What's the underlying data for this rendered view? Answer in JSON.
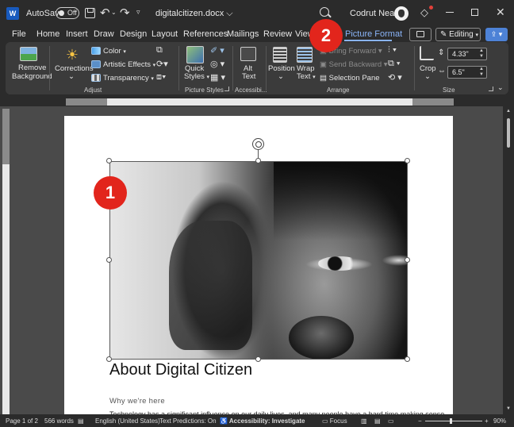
{
  "titlebar": {
    "autosave_label": "AutoSave",
    "autosave_state": "Off",
    "doc_title": "digitalcitizen.docx",
    "doc_title_caret": "⌵",
    "user_name": "Codrut Neagu",
    "app_logo": "W"
  },
  "tabs": [
    "File",
    "Home",
    "Insert",
    "Draw",
    "Design",
    "Layout",
    "References",
    "Mailings",
    "Review",
    "View",
    "Picture Format"
  ],
  "active_tab": "Picture Format",
  "editing_label": "Editing",
  "ribbon": {
    "remove_background": [
      "Remove",
      "Background"
    ],
    "corrections": "Corrections",
    "color": "Color",
    "artistic_effects": "Artistic Effects",
    "transparency": "Transparency",
    "adjust_label": "Adjust",
    "quick_styles": [
      "Quick",
      "Styles"
    ],
    "picture_styles_label": "Picture Styles",
    "alt_text": [
      "Alt",
      "Text"
    ],
    "accessibility_label": "Accessibi...",
    "position": "Position",
    "wrap_text": [
      "Wrap",
      "Text"
    ],
    "bring_forward": "Bring Forward",
    "send_backward": "Send Backward",
    "selection_pane": "Selection Pane",
    "arrange_label": "Arrange",
    "crop": "Crop",
    "height_value": "4.33\"",
    "width_value": "6.5\"",
    "size_label": "Size"
  },
  "document": {
    "heading": "About Digital Citizen",
    "subheading": "Why we're here",
    "body_preview": "Technology has a significant influence on our daily lives, and many people have a hard time making sense"
  },
  "callouts": [
    "1",
    "2"
  ],
  "statusbar": {
    "page": "Page 1 of 2",
    "words": "566 words",
    "language": "English (United States)",
    "predictions": "Text Predictions: On",
    "accessibility": "Accessibility: Investigate",
    "focus": "Focus",
    "zoom_minus": "−",
    "zoom_plus": "+",
    "zoom": "90%"
  },
  "zoom_level": 0.9,
  "colors": {
    "accent": "#8ab4f8",
    "callout": "#e2251c",
    "share": "#4d82d6",
    "word_blue": "#185abd"
  },
  "icons": [
    "word-logo-icon",
    "save-icon",
    "undo-icon",
    "redo-icon",
    "search-icon",
    "diamond-icon",
    "minimize-icon",
    "maximize-icon",
    "close-icon",
    "comment-icon",
    "share-icon",
    "remove-background-icon",
    "corrections-icon",
    "color-icon",
    "artistic-effects-icon",
    "transparency-icon",
    "quick-styles-icon",
    "alt-text-icon",
    "position-icon",
    "wrap-text-icon",
    "crop-icon",
    "rotate-handle-icon"
  ]
}
